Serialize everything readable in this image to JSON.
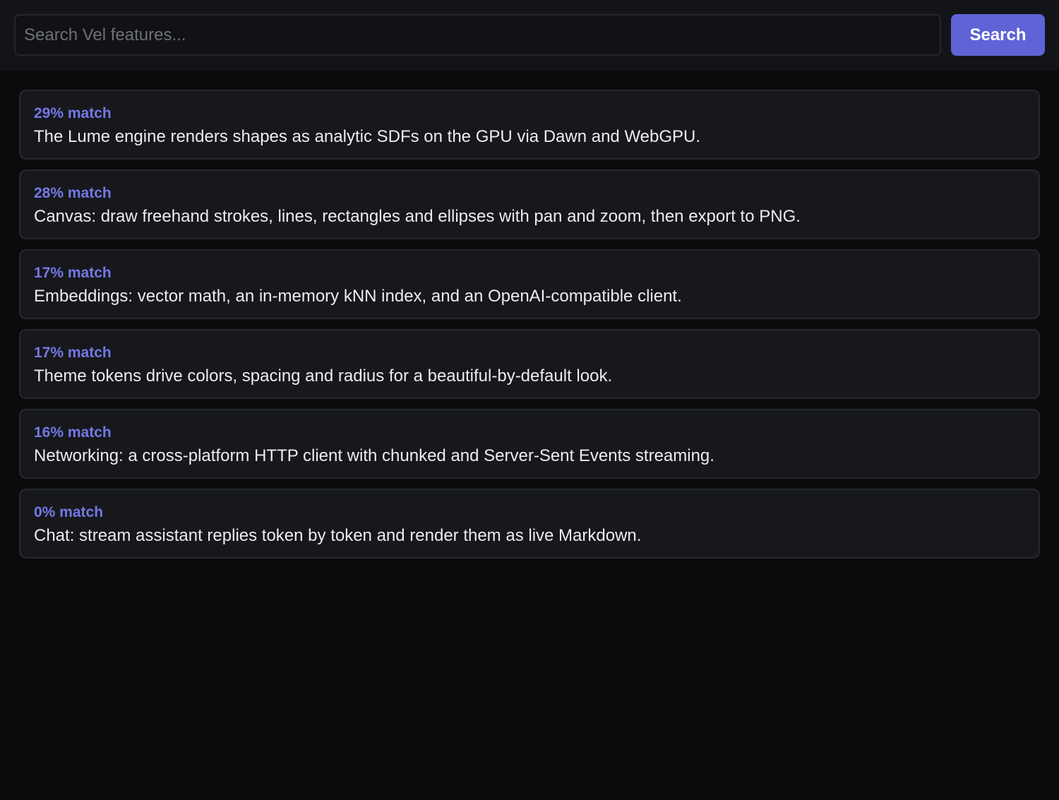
{
  "search": {
    "placeholder": "Search Vel features...",
    "value": "",
    "button_label": "Search"
  },
  "results": [
    {
      "score": "29% match",
      "text": "The Lume engine renders shapes as analytic SDFs on the GPU via Dawn and WebGPU."
    },
    {
      "score": "28% match",
      "text": "Canvas: draw freehand strokes, lines, rectangles and ellipses with pan and zoom, then export to PNG."
    },
    {
      "score": "17% match",
      "text": "Embeddings: vector math, an in-memory kNN index, and an OpenAI-compatible client."
    },
    {
      "score": "17% match",
      "text": "Theme tokens drive colors, spacing and radius for a beautiful-by-default look."
    },
    {
      "score": "16% match",
      "text": "Networking: a cross-platform HTTP client with chunked and Server-Sent Events streaming."
    },
    {
      "score": "0% match",
      "text": "Chat: stream assistant replies token by token and render them as live Markdown."
    }
  ],
  "colors": {
    "background": "#0b0b0c",
    "topbar": "#131418",
    "card": "#17181c",
    "accent": "#5f63d6",
    "score_text": "#7478e6"
  }
}
